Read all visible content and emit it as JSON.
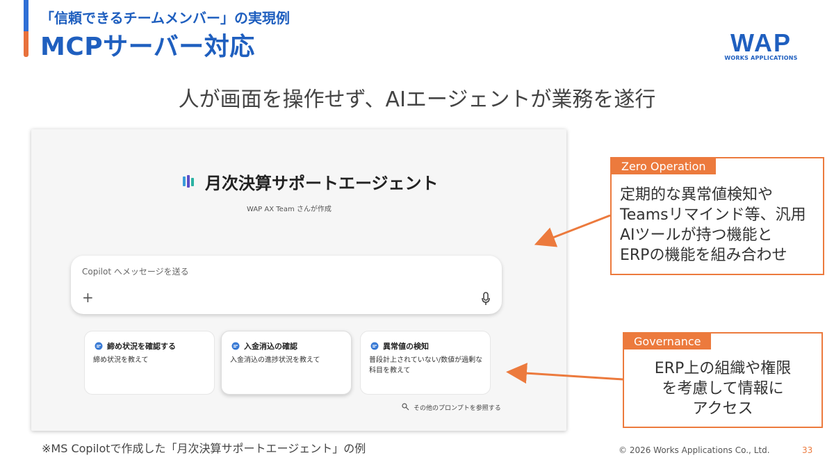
{
  "header": {
    "subtitle": "「信頼できるチームメンバー」の実現例",
    "title": "MCPサーバー対応",
    "logo_text": "WAP",
    "logo_subtext": "WORKS APPLICATIONS"
  },
  "headline": "人が画面を操作せず、AIエージェントが業務を遂行",
  "screenshot": {
    "agent_title": "月次決算サポートエージェント",
    "agent_creator": "WAP AX Team さんが作成",
    "input_placeholder": "Copilot へメッセージを送る",
    "plus_label": "+",
    "prompt_cards": [
      {
        "title": "締め状況を確認する",
        "body": "締め状況を教えて"
      },
      {
        "title": "入金消込の確認",
        "body": "入金消込の進捗状況を教えて"
      },
      {
        "title": "異常値の検知",
        "body": "普段計上されていない/数値が過剰な科目を教えて"
      }
    ],
    "more_prompts_label": "その他のプロンプトを参照する"
  },
  "callouts": {
    "zero_operation": {
      "tag": "Zero Operation",
      "lines": [
        "定期的な異常値検知や",
        "Teamsリマインド等、汎用",
        "AIツールが持つ機能と",
        "ERPの機能を組み合わせ"
      ]
    },
    "governance": {
      "tag": "Governance",
      "lines": [
        "ERP上の組織や権限",
        "を考慮して情報に",
        "アクセス"
      ]
    }
  },
  "footer": {
    "note": "※MS Copilotで作成した「月次決算サポートエージェント」の例",
    "copyright": "© 2026 Works Applications Co., Ltd.",
    "page_number": "33"
  },
  "colors": {
    "brand_blue": "#1f5fbf",
    "accent_orange": "#ec7a3d"
  }
}
